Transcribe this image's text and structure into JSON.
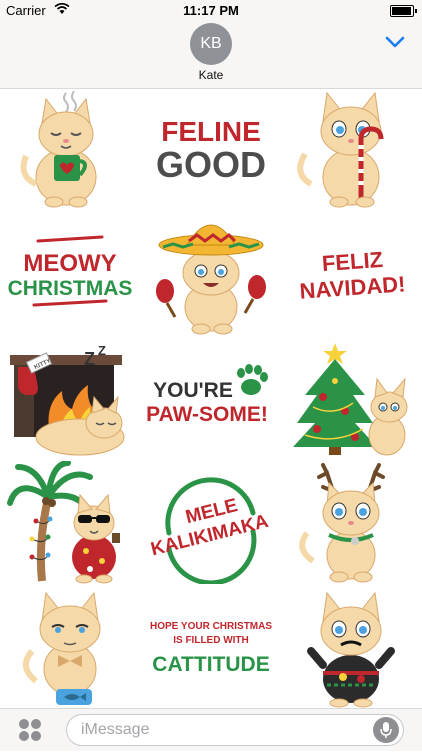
{
  "status_bar": {
    "carrier": "Carrier",
    "time": "11:17 PM",
    "battery_level": 0.95
  },
  "header": {
    "avatar_initials": "KB",
    "contact_name": "Kate"
  },
  "stickers": [
    {
      "name": "sticker-cat-cocoa",
      "icon": "cat-with-mug"
    },
    {
      "name": "sticker-feline-good",
      "lines": [
        "FELINE",
        "GOOD"
      ],
      "colors": [
        "#c0272d",
        "#4d4d4d"
      ]
    },
    {
      "name": "sticker-cat-candy-cane",
      "icon": "cat-with-candy-cane"
    },
    {
      "name": "sticker-meowy-christmas",
      "lines": [
        "MEOWY",
        "CHRISTMAS"
      ],
      "colors": [
        "#c0272d",
        "#2b9348"
      ]
    },
    {
      "name": "sticker-cat-sombrero",
      "icon": "cat-with-sombrero-maracas"
    },
    {
      "name": "sticker-feliz-navidad",
      "lines": [
        "FELIZ",
        "NAVIDAD!"
      ],
      "colors": [
        "#c0272d",
        "#c0272d"
      ]
    },
    {
      "name": "sticker-cat-fireplace",
      "icon": "cat-sleeping-fireplace",
      "stocking_label": "KITTY"
    },
    {
      "name": "sticker-pawsome",
      "lines": [
        "YOU'RE",
        "PAW-SOME!"
      ],
      "colors": [
        "#333333",
        "#c0272d"
      ]
    },
    {
      "name": "sticker-cat-christmas-tree",
      "icon": "cat-with-christmas-tree"
    },
    {
      "name": "sticker-cat-palm-tree",
      "icon": "cat-palm-tree-sunglasses"
    },
    {
      "name": "sticker-mele-kalikimaka",
      "lines": [
        "MELE",
        "KALIKIMAKA"
      ],
      "colors": [
        "#c0272d",
        "#c0272d"
      ]
    },
    {
      "name": "sticker-cat-reindeer",
      "icon": "cat-with-antlers"
    },
    {
      "name": "sticker-cat-bowtie",
      "icon": "cat-bowtie-fish-bowl"
    },
    {
      "name": "sticker-cattitude",
      "lines": [
        "HOPE YOUR CHRISTMAS",
        "IS FILLED WITH",
        "CATTITUDE"
      ],
      "colors": [
        "#c0272d",
        "#c0272d",
        "#2b9348"
      ]
    },
    {
      "name": "sticker-cat-ugly-sweater",
      "icon": "cat-ugly-sweater"
    }
  ],
  "input_bar": {
    "placeholder": "iMessage"
  },
  "colors": {
    "fur": "#f5d9a8",
    "fur_dark": "#d9a86c",
    "red": "#c0272d",
    "green": "#2b9348",
    "accent": "#1a7cf0"
  }
}
